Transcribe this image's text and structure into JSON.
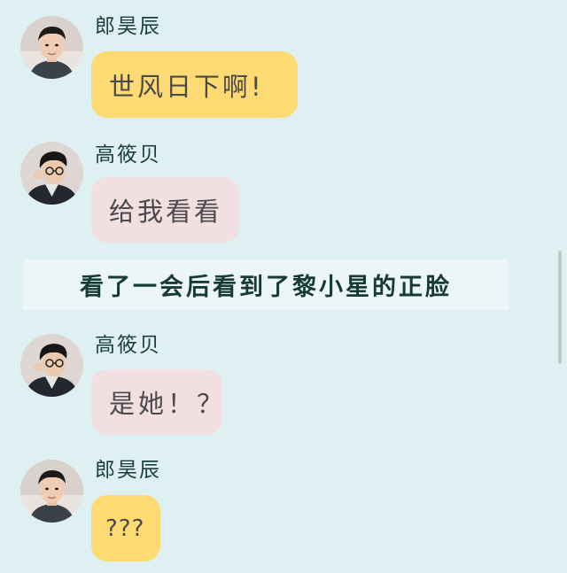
{
  "messages": [
    {
      "sender": "郎昊辰",
      "text": "世风日下啊!",
      "bubble_color": "#fddb72"
    },
    {
      "sender": "高筱贝",
      "text": "给我看看",
      "bubble_color": "#f1dfe1"
    },
    {
      "narration": "看了一会后看到了黎小星的正脸"
    },
    {
      "sender": "高筱贝",
      "text": "是她！？",
      "bubble_color": "#f1dfe1"
    },
    {
      "sender": "郎昊辰",
      "text": "???",
      "bubble_color": "#fddb72"
    }
  ],
  "colors": {
    "background": "#def0f1",
    "name_text": "#1b3e3f",
    "bubble_text": "#4a4a4a",
    "narration_bg": "#ecf6f8"
  },
  "icons": {
    "avatar_male": "avatar-male-icon",
    "avatar_glasses": "avatar-glasses-icon"
  }
}
